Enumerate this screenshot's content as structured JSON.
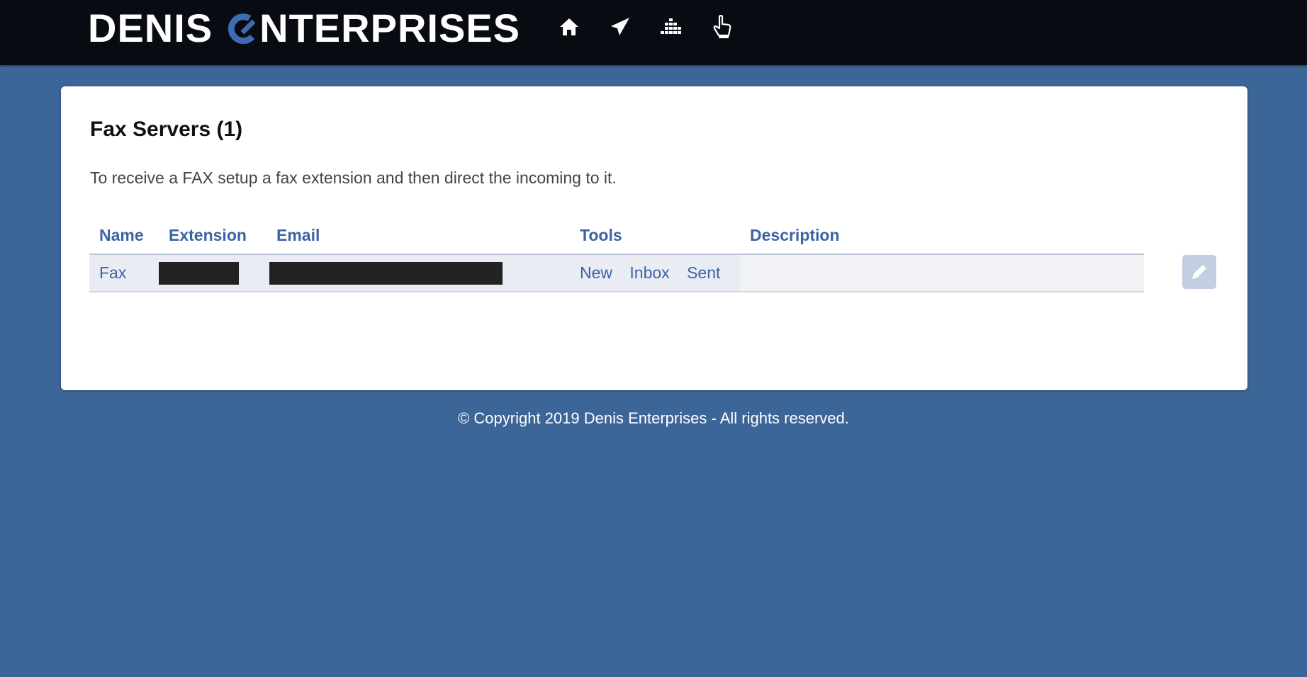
{
  "header": {
    "logo_word1": "DENIS",
    "logo_word2": "NTERPRISES",
    "nav_icons": [
      "home-icon",
      "paper-plane-icon",
      "dashboard-icon",
      "pointer-hand-icon"
    ]
  },
  "card": {
    "title": "Fax Servers (1)",
    "description": "To receive a FAX setup a fax extension and then direct the incoming to it."
  },
  "table": {
    "columns": [
      "Name",
      "Extension",
      "Email",
      "Tools",
      "Description"
    ],
    "rows": [
      {
        "name": "Fax",
        "extension": "",
        "email": "",
        "tools": [
          "New",
          "Inbox",
          "Sent"
        ],
        "description": ""
      }
    ]
  },
  "footer": {
    "copyright": "© Copyright 2019 Denis Enterprises - All rights reserved."
  },
  "colors": {
    "background": "#3d6698",
    "topbar": "#080c12",
    "link": "#3c63a6",
    "row_bg": "#e9edf3",
    "edit_button": "#c3cfe0"
  }
}
